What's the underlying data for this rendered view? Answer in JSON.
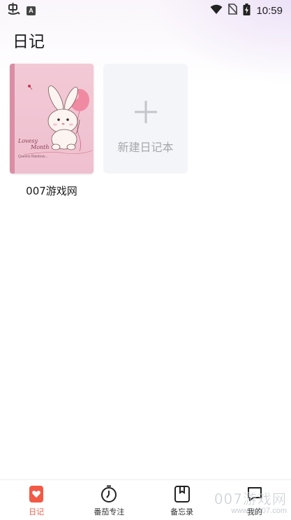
{
  "status_bar": {
    "time": "10:59",
    "left_icons": [
      "app-notification-icon",
      "a-badge-icon"
    ],
    "right_icons": [
      "wifi-icon",
      "no-sim-icon",
      "battery-charging-icon"
    ],
    "a_badge_letter": "A"
  },
  "header": {
    "title": "日记"
  },
  "diaries": [
    {
      "name": "007游戏网",
      "cover": {
        "style": "pink-bunny-balloon",
        "bg_color": "#f2c5d3",
        "spine_color": "#d98ea6",
        "text_line1": "Lovesy",
        "text_line2": "Month",
        "text_line3": "Queens Rainbow..."
      }
    }
  ],
  "new_diary": {
    "label": "新建日记本",
    "icon": "plus-icon"
  },
  "bottom_nav": {
    "items": [
      {
        "label": "日记",
        "icon": "diary-heart-icon",
        "active": true
      },
      {
        "label": "番茄专注",
        "icon": "stopwatch-icon",
        "active": false
      },
      {
        "label": "备忘录",
        "icon": "bookmark-note-icon",
        "active": false
      },
      {
        "label": "我的",
        "icon": "profile-chat-icon",
        "active": false
      }
    ],
    "active_color": "#f25a45"
  },
  "watermark": {
    "line1": "007游戏网",
    "line2": "www.yx007.com"
  }
}
